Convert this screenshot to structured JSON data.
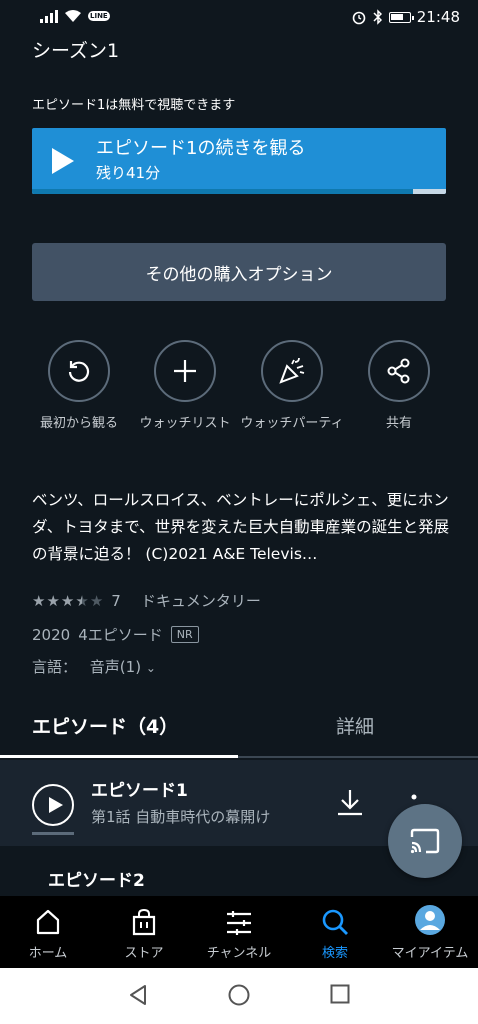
{
  "status_bar": {
    "time": "21:48",
    "line_badge": "LINE"
  },
  "season": {
    "title": "シーズン1"
  },
  "free_note": "エピソード1は無料で視聴できます",
  "play_button": {
    "title": "エピソード1の続きを観る",
    "subtitle": "残り41分",
    "progress": 0.92
  },
  "buy_button": {
    "label": "その他の購入オプション"
  },
  "actions": [
    {
      "label": "最初から観る",
      "icon": "restart-icon"
    },
    {
      "label": "ウォッチリスト",
      "icon": "plus-icon"
    },
    {
      "label": "ウォッチパーティ",
      "icon": "party-popper-icon"
    },
    {
      "label": "共有",
      "icon": "share-icon"
    }
  ],
  "description": "ベンツ、ロールスロイス、ベントレーにポルシェ、更にホンダ、トヨタまで、世界を変えた巨大自動車産業の誕生と発展の背景に迫る！ (C)2021 A&E Televis…",
  "rating": {
    "stars": 3.5,
    "count": "7",
    "genre": "ドキュメンタリー"
  },
  "meta": {
    "year": "2020",
    "episodes": "4エピソード",
    "badge": "NR"
  },
  "language": {
    "label": "言語：",
    "value": "音声(1)"
  },
  "tabs": {
    "episodes": "エピソード（4）",
    "details": "詳細"
  },
  "episode1": {
    "title": "エピソード1",
    "subtitle": "第1話 自動車時代の幕開け"
  },
  "episode2": {
    "title": "エピソード2"
  },
  "bottom_nav": [
    {
      "label": "ホーム",
      "icon": "home-icon"
    },
    {
      "label": "ストア",
      "icon": "store-bag-icon"
    },
    {
      "label": "チャンネル",
      "icon": "channels-icon"
    },
    {
      "label": "検索",
      "icon": "search-icon"
    },
    {
      "label": "マイアイテム",
      "icon": "avatar-icon"
    }
  ],
  "colors": {
    "background": "#0f171e",
    "accent": "#1f8fd6",
    "active_nav": "#1a98ff"
  }
}
